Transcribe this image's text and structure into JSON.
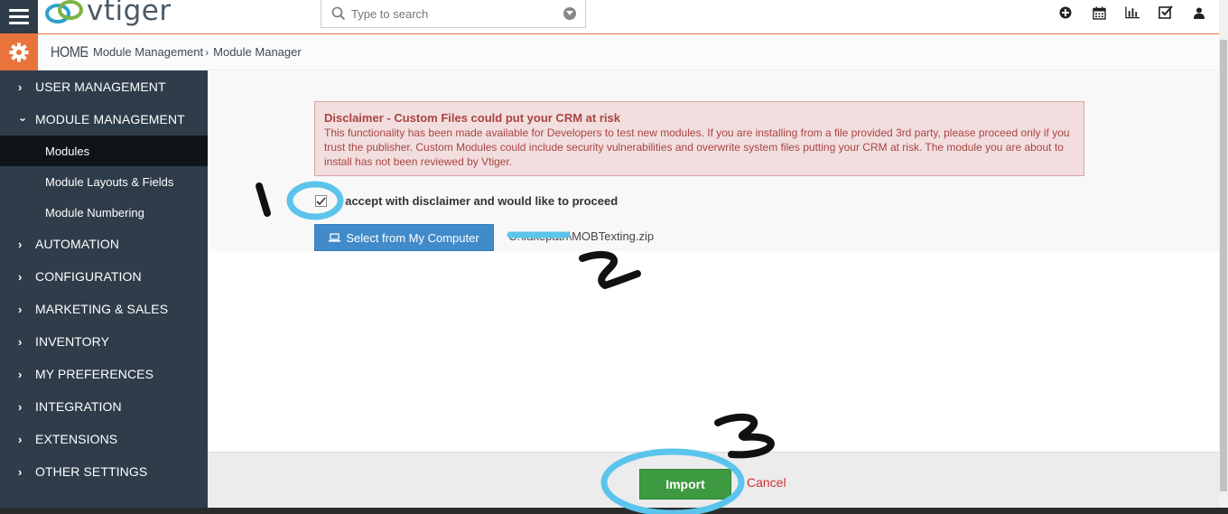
{
  "app": {
    "logo_text": "vtiger"
  },
  "search": {
    "placeholder": "Type to search"
  },
  "top_icons": [
    "plus-circle-icon",
    "calendar-icon",
    "bar-chart-icon",
    "checkbox-icon",
    "user-icon"
  ],
  "breadcrumb": {
    "home": "HOME",
    "items": [
      "Module Management",
      "Module Manager"
    ]
  },
  "sidebar": {
    "sections": [
      {
        "label": "USER MANAGEMENT",
        "expanded": false
      },
      {
        "label": "MODULE MANAGEMENT",
        "expanded": true
      },
      {
        "label": "AUTOMATION",
        "expanded": false
      },
      {
        "label": "CONFIGURATION",
        "expanded": false
      },
      {
        "label": "MARKETING & SALES",
        "expanded": false
      },
      {
        "label": "INVENTORY",
        "expanded": false
      },
      {
        "label": "MY PREFERENCES",
        "expanded": false
      },
      {
        "label": "INTEGRATION",
        "expanded": false
      },
      {
        "label": "EXTENSIONS",
        "expanded": false
      },
      {
        "label": "OTHER SETTINGS",
        "expanded": false
      }
    ],
    "sub_items": [
      {
        "label": "Modules",
        "active": true
      },
      {
        "label": "Module Layouts & Fields",
        "active": false
      },
      {
        "label": "Module Numbering",
        "active": false
      }
    ]
  },
  "disclaimer": {
    "title": "Disclaimer - Custom Files could put your CRM at risk",
    "body": "This functionality has been made available for Developers to test new modules. If you are installing from a file provided 3rd party, please proceed only if you trust the publisher. Custom Modules could include security vulnerabilities and overwrite system files putting your CRM at risk. The module you are about to install has not been reviewed by Vtiger."
  },
  "accept": {
    "label": "I accept with disclaimer and would like to proceed",
    "checked": true
  },
  "upload": {
    "button_label": "Select from My Computer",
    "filename": "C:\\fakepath\\MOBTexting.zip"
  },
  "footer": {
    "import_label": "Import",
    "cancel_label": "Cancel"
  },
  "annotations": {
    "step1": "1",
    "step2": "2",
    "step3": "3"
  },
  "colors": {
    "sidebar_bg": "#2f3d4a",
    "accent_orange": "#e8743b",
    "primary_blue": "#428bca",
    "success_green": "#3d9a41",
    "danger_red": "#d32f2f",
    "disclaimer_bg": "#f2dede",
    "disclaimer_text": "#a94442",
    "annotation_blue": "#5bc4ec"
  }
}
